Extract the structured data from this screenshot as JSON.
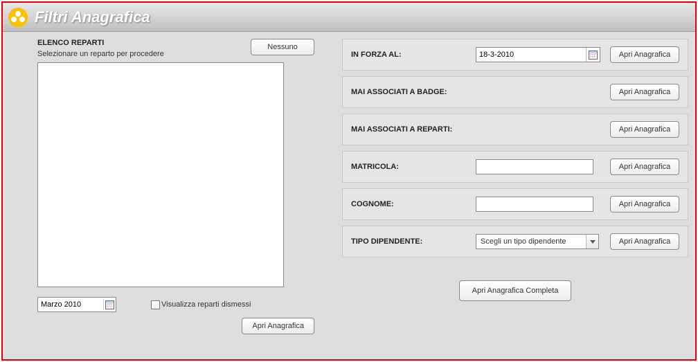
{
  "header": {
    "title": "Filtri Anagrafica"
  },
  "left": {
    "title": "ELENCO REPARTI",
    "subtitle": "Selezionare un reparto per procedere",
    "nessuno_label": "Nessuno",
    "month_value": "Marzo  2010",
    "dismessi_label": "Visualizza reparti dismessi",
    "apri_label": "Apri Anagrafica"
  },
  "filters": {
    "in_forza": {
      "label": "IN FORZA AL:",
      "value": "18-3-2010",
      "apri": "Apri Anagrafica"
    },
    "badge": {
      "label": "MAI ASSOCIATI A BADGE:",
      "apri": "Apri Anagrafica"
    },
    "reparti": {
      "label": "MAI ASSOCIATI A REPARTI:",
      "apri": "Apri Anagrafica"
    },
    "matricola": {
      "label": "MATRICOLA:",
      "value": "",
      "apri": "Apri Anagrafica"
    },
    "cognome": {
      "label": "COGNOME:",
      "value": "",
      "apri": "Apri Anagrafica"
    },
    "tipo": {
      "label": "TIPO DIPENDENTE:",
      "placeholder": "Scegli un tipo dipendente",
      "apri": "Apri Anagrafica"
    }
  },
  "complete_button": "Apri Anagrafica Completa"
}
